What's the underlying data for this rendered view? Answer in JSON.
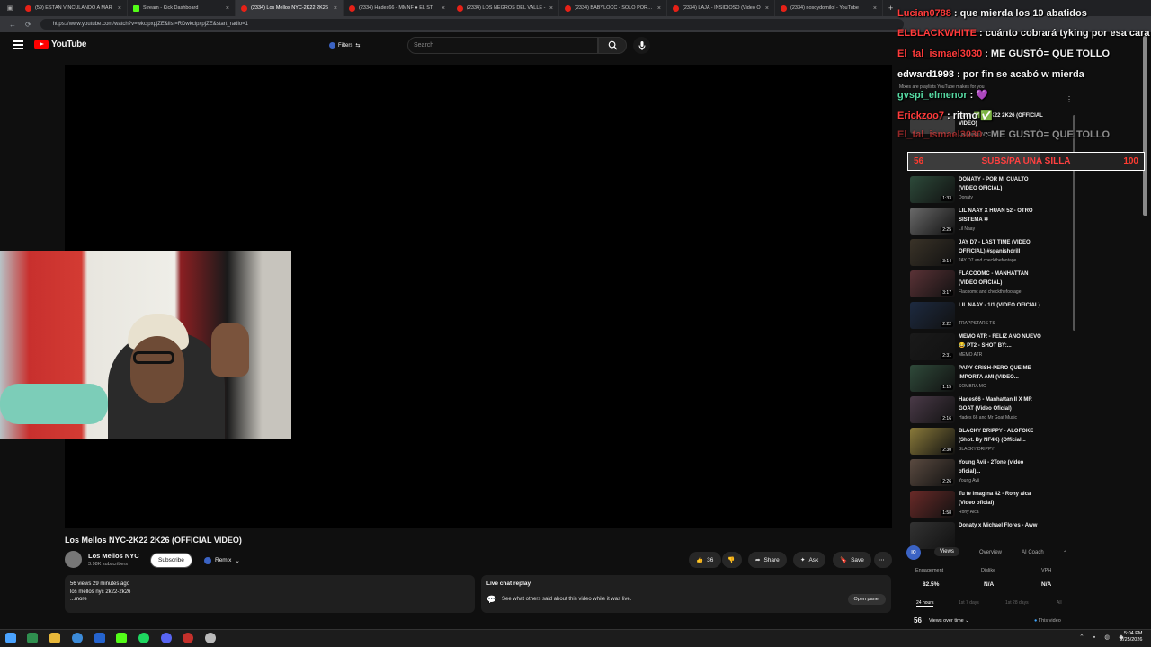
{
  "browser": {
    "tabs": [
      {
        "title": "(59) ESTÁN VINCULANDO A MAR",
        "type": "yt"
      },
      {
        "title": "Stream - Kick Dashboard",
        "type": "kick"
      },
      {
        "title": "(2334) Los Mellos NYC-2K22 2K26",
        "type": "yt",
        "active": true
      },
      {
        "title": "(2334) Hades66 - MMNF ● EL ST",
        "type": "yt"
      },
      {
        "title": "(2334) LOS NEGROS DEL VALLE -",
        "type": "yt"
      },
      {
        "title": "(2334) BABYLOCC - SOLO POR DI",
        "type": "yt"
      },
      {
        "title": "(2334) LAJA - INSIDIOSO (Video O",
        "type": "yt"
      },
      {
        "title": "(2334) nosoydomilol - YouTube",
        "type": "yt"
      }
    ],
    "url": "https://www.youtube.com/watch?v=wkcipxpjZE&list=RDwkcipxpjZE&start_radio=1"
  },
  "header": {
    "logo": "YouTube",
    "filters_label": "Filters",
    "search_placeholder": "Search"
  },
  "video": {
    "title": "Los Mellos NYC-2K22 2K26 (OFFICIAL VIDEO)",
    "channel": "Los Mellos NYC",
    "subscribers": "3.98K subscribers",
    "subscribe_label": "Subscribe",
    "remix_label": "Remix",
    "likes": "36",
    "share_label": "Share",
    "ask_label": "Ask",
    "save_label": "Save",
    "desc_line1": "56 views  29 minutes ago",
    "desc_line2": "los mellos nyc 2k22-2k26",
    "desc_more": "...more"
  },
  "live_chat": {
    "title": "Live chat replay",
    "subtitle": "See what others said about this video while it was live.",
    "open_label": "Open panel"
  },
  "playlist": {
    "mix_info": "Mixes are playlists YouTube makes for you",
    "current_title": "ritmo ✅ C-2K22 2K26 (OFFICIAL VIDEO)",
    "current_channel": "Los Mellos NYC",
    "items": [
      {
        "title": "DONATY - POR MI CUALTO (VIDEO OFICIAL)",
        "channel": "Donaty",
        "duration": "1:33",
        "color": "#2d4a3a"
      },
      {
        "title": "LIL NAAY X HUAN 52 - OTRO SISTEMA ❄",
        "channel": "Lil Naay",
        "duration": "2:25",
        "color": "#6a6a6a"
      },
      {
        "title": "JAY D7 - LAST TIME (VIDEO OFFICIAL) #spanishdrill",
        "channel": "JAY D7 and checkthefootage",
        "duration": "3:14",
        "color": "#3a3328"
      },
      {
        "title": "FLACOOMC - MANHATTAN (VIDEO OFICIAL)",
        "channel": "Flacoomc and checkthefootage",
        "duration": "3:17",
        "color": "#5a3236"
      },
      {
        "title": "LIL NAAY - 1/1 (VIDEO OFICIAL)",
        "channel": "TRAPPSTARS TS",
        "duration": "2:22",
        "color": "#1d2a40"
      },
      {
        "title": "MEMO ATR - FELIZ AÑO NUEVO 😂 PT2 - SHOT BY:...",
        "channel": "MEMO ATR",
        "duration": "2:31",
        "color": "#1a1a1a"
      },
      {
        "title": "PAPY CRISH-PERO QUE ME IMPORTA AMI (VIDEO...",
        "channel": "SOMBRA MC",
        "duration": "1:15",
        "color": "#2f4a3a"
      },
      {
        "title": "Hades66 - Manhattan II X MR GOAT (Video Oficial)",
        "channel": "Hades 66 and Mr Goat Music",
        "duration": "2:16",
        "color": "#4a3a48"
      },
      {
        "title": "BLACKY DRIPPY - ALOFOKE (Shot. By NF4K) (Official...",
        "channel": "BLACKY DRIPPY",
        "duration": "2:30",
        "color": "#8a7a3a"
      },
      {
        "title": "Young Avii - 2Tone (video oficial)...",
        "channel": "Young Avii",
        "duration": "2:26",
        "color": "#5a4a40"
      },
      {
        "title": "Tu te imagina 42 - Rony alca (Video oficial)",
        "channel": "Rony Alca",
        "duration": "1:58",
        "color": "#6a2a28"
      },
      {
        "title": "Donaty x Michael Flores - Aww",
        "channel": "",
        "duration": "",
        "color": "#333333"
      }
    ]
  },
  "analytics": {
    "logo": "IQ",
    "tabs": [
      "Views",
      "Overview",
      "AI Coach"
    ],
    "labels": [
      "Engagement",
      "Dislike",
      "VPH"
    ],
    "values": [
      "82.5%",
      "N/A",
      "N/A"
    ],
    "ranges": [
      "24 hours",
      "1st 7 days",
      "1st 28 days",
      "All"
    ],
    "views": "56",
    "views_over_time": "Views over time",
    "this_video": "This video"
  },
  "chat_overlay": {
    "messages": [
      {
        "user": "Lucian0788",
        "text": ": que mierda los 10 abatidos",
        "user_color": "#ff3b3b"
      },
      {
        "user": "ELBLACKWHITE",
        "text": ": cuánto cobrará tyking por esa cara",
        "user_color": "#ff3b3b"
      },
      {
        "user": "El_tal_ismael3030",
        "text": ": ME GUSTÓ= QUE TOLLO",
        "user_color": "#ff3b3b"
      },
      {
        "user": "edward1998",
        "text": ": por fin se acabó w mierda",
        "user_color": "#ffffff"
      },
      {
        "user": "gvspi_elmenor",
        "text": ": 💜",
        "user_color": "#57d9a3"
      },
      {
        "user": "Erickzoo7",
        "text": ": ritmo ✅",
        "user_color": "#ff3b3b"
      },
      {
        "user": "El_tal_ismael3030",
        "text": ": ME GUSTÓ= QUE TOLLO",
        "user_color": "#ff3b3b"
      }
    ],
    "goal": {
      "current": "56",
      "label": "SUBS/PA UNA SILLA",
      "target": "100",
      "fraction": 0.56
    }
  },
  "taskbar": {
    "time": "5:04 PM",
    "date": "2/25/2026"
  }
}
